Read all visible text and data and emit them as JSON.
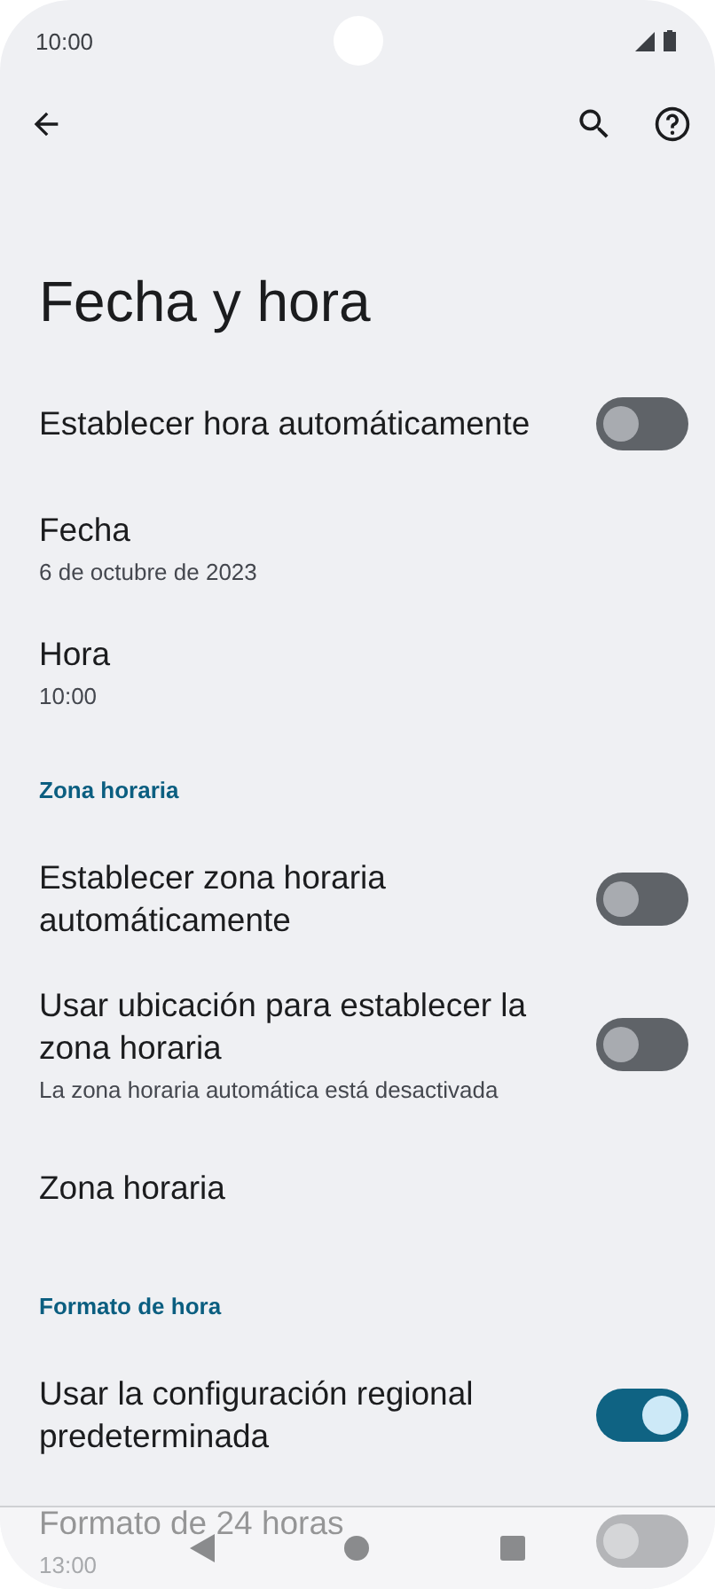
{
  "status_bar": {
    "time": "10:00"
  },
  "toolbar": {
    "title": "Fecha y hora"
  },
  "items": [
    {
      "kind": "switch",
      "title": "Establecer hora automáticamente",
      "on": false
    },
    {
      "kind": "text",
      "title": "Fecha",
      "summary": "6 de octubre de 2023"
    },
    {
      "kind": "text",
      "title": "Hora",
      "summary": "10:00"
    },
    {
      "kind": "header",
      "title": "Zona horaria"
    },
    {
      "kind": "switch",
      "title": "Establecer zona horaria automáticamente",
      "on": false
    },
    {
      "kind": "switch",
      "title": "Usar ubicación para establecer la zona horaria",
      "summary": "La zona horaria automática está desactivada",
      "on": false
    },
    {
      "kind": "text",
      "title": "Zona horaria"
    },
    {
      "kind": "header",
      "title": "Formato de hora"
    },
    {
      "kind": "switch",
      "title": "Usar la configuración regional predeterminada",
      "on": true
    },
    {
      "kind": "switch",
      "title": "Formato de 24 horas",
      "summary": "13:00",
      "on": false
    }
  ]
}
